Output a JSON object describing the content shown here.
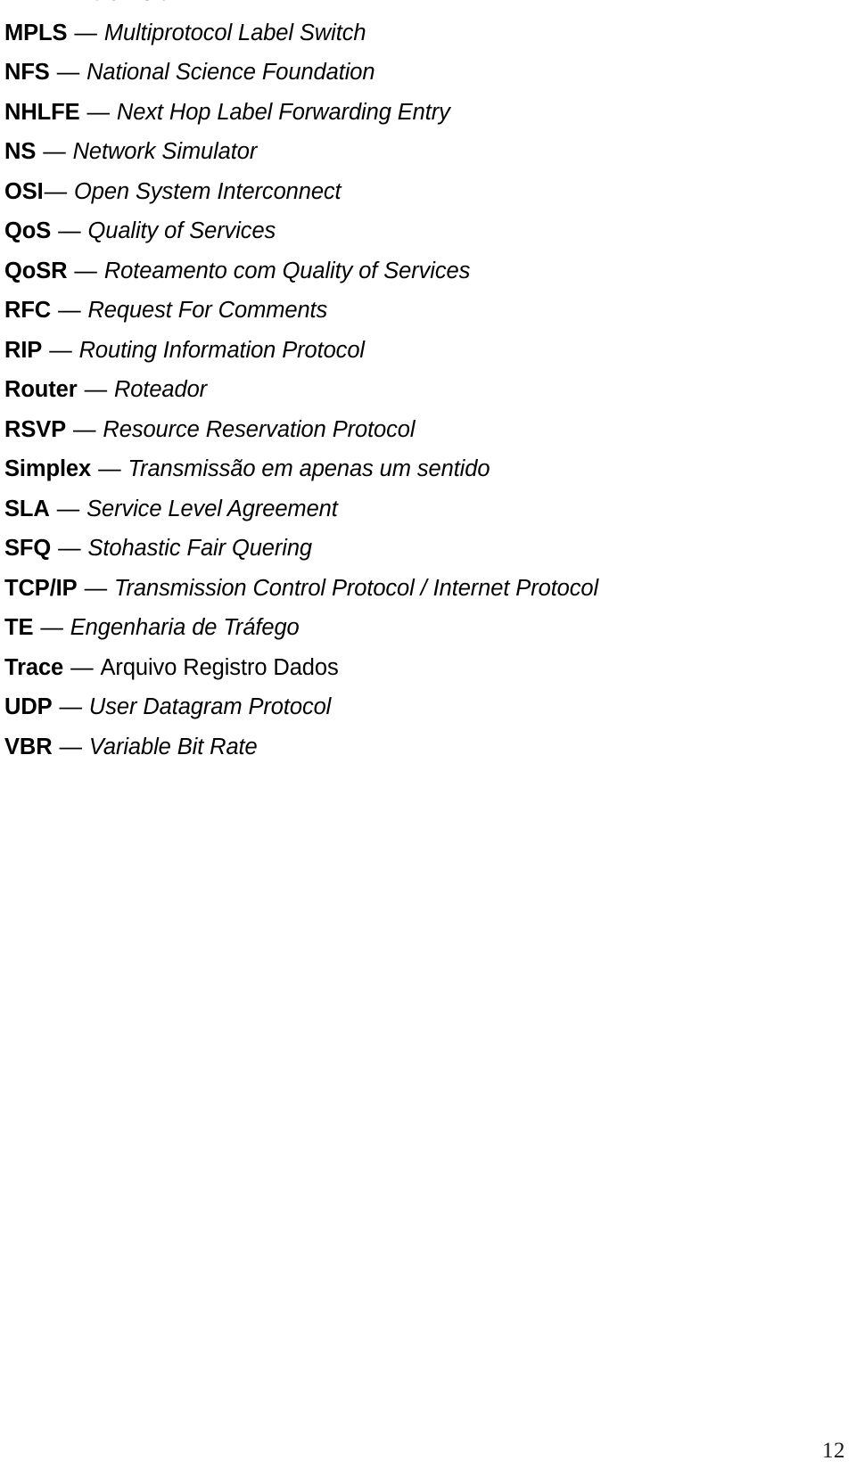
{
  "document": {
    "type": "glossary",
    "language": "pt-BR",
    "page_number": "12"
  },
  "glossary": {
    "entries": [
      {
        "term": "MF",
        "separator": "—",
        "space_before_dash": " ",
        "definition": "Mult Field",
        "definition_style": "italic"
      },
      {
        "term": "MPLS",
        "separator": "—",
        "space_before_dash": " ",
        "definition": "Multiprotocol Label Switch",
        "definition_style": "italic"
      },
      {
        "term": "NFS",
        "separator": "—",
        "space_before_dash": " ",
        "definition": "National Science Foundation",
        "definition_style": "italic"
      },
      {
        "term": "NHLFE",
        "separator": "—",
        "space_before_dash": " ",
        "definition": "Next Hop Label Forwarding Entry",
        "definition_style": "italic"
      },
      {
        "term": "NS",
        "separator": "—",
        "space_before_dash": " ",
        "definition": "Network Simulator",
        "definition_style": "italic"
      },
      {
        "term": "OSI",
        "separator": "—",
        "space_before_dash": "",
        "definition": "Open System Interconnect",
        "definition_style": "italic"
      },
      {
        "term": "QoS",
        "separator": "—",
        "space_before_dash": " ",
        "definition": "Quality of Services",
        "definition_style": "italic"
      },
      {
        "term": "QoSR",
        "separator": "—",
        "space_before_dash": " ",
        "definition": "Roteamento com Quality of Services",
        "definition_style": "italic"
      },
      {
        "term": "RFC",
        "separator": "—",
        "space_before_dash": " ",
        "definition": "Request For Comments",
        "definition_style": "italic"
      },
      {
        "term": "RIP",
        "separator": "—",
        "space_before_dash": " ",
        "definition": "Routing Information Protocol",
        "definition_style": "italic"
      },
      {
        "term": "Router",
        "separator": "—",
        "space_before_dash": "  ",
        "definition": "Roteador",
        "definition_style": "italic"
      },
      {
        "term": "RSVP",
        "separator": "—",
        "space_before_dash": " ",
        "definition": "Resource Reservation Protocol",
        "definition_style": "italic"
      },
      {
        "term": "Simplex",
        "separator": "—",
        "space_before_dash": " ",
        "definition": "Transmissão em apenas um sentido",
        "definition_style": "italic"
      },
      {
        "term": "SLA",
        "separator": "—",
        "space_before_dash": " ",
        "definition": "Service Level Agreement",
        "definition_style": "italic"
      },
      {
        "term": "SFQ",
        "separator": "—",
        "space_before_dash": " ",
        "definition": "Stohastic Fair Quering",
        "definition_style": "italic"
      },
      {
        "term": "TCP/IP",
        "separator": "—",
        "space_before_dash": " ",
        "definition": "Transmission Control Protocol / Internet Protocol",
        "definition_style": "italic"
      },
      {
        "term": "TE",
        "separator": "—",
        "space_before_dash": " ",
        "definition": "Engenharia de Tráfego",
        "definition_style": "italic"
      },
      {
        "term": "Trace",
        "separator": "—",
        "space_before_dash": " ",
        "definition": "Arquivo Registro Dados",
        "definition_style": "upright"
      },
      {
        "term": "UDP",
        "separator": "—",
        "space_before_dash": "  ",
        "definition": "User Datagram Protocol",
        "definition_style": "italic"
      },
      {
        "term": "VBR",
        "separator": "—",
        "space_before_dash": " ",
        "definition": "Variable Bit Rate",
        "definition_style": "italic"
      }
    ]
  },
  "footer": {
    "page_number": "12"
  },
  "colors": {
    "text": "#000000",
    "background": "#ffffff",
    "page_number": "#1a1a1a"
  }
}
